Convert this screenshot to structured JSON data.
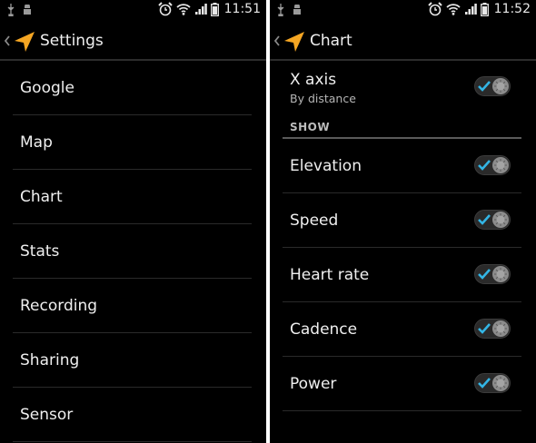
{
  "left_screen": {
    "status_bar": {
      "time": "11:51"
    },
    "action_bar": {
      "title": "Settings"
    },
    "items": [
      {
        "label": "Google"
      },
      {
        "label": "Map"
      },
      {
        "label": "Chart"
      },
      {
        "label": "Stats"
      },
      {
        "label": "Recording"
      },
      {
        "label": "Sharing"
      },
      {
        "label": "Sensor"
      }
    ]
  },
  "right_screen": {
    "status_bar": {
      "time": "11:52"
    },
    "action_bar": {
      "title": "Chart"
    },
    "x_axis": {
      "label": "X axis",
      "summary": "By distance",
      "checked": true
    },
    "section": {
      "label": "SHOW"
    },
    "items": [
      {
        "label": "Elevation",
        "checked": true
      },
      {
        "label": "Speed",
        "checked": true
      },
      {
        "label": "Heart rate",
        "checked": true
      },
      {
        "label": "Cadence",
        "checked": true
      },
      {
        "label": "Power",
        "checked": true
      }
    ]
  },
  "icons": {
    "usb": "usb-icon",
    "android": "android-debug-icon",
    "alarm": "alarm-icon",
    "wifi": "wifi-icon",
    "signal": "signal-icon",
    "battery": "battery-icon",
    "app": "navigation-arrow-icon",
    "back": "back-caret-icon",
    "check": "check-icon"
  },
  "colors": {
    "accent_orange": "#f5a623",
    "check_blue": "#33b5e5",
    "background": "#000000"
  }
}
